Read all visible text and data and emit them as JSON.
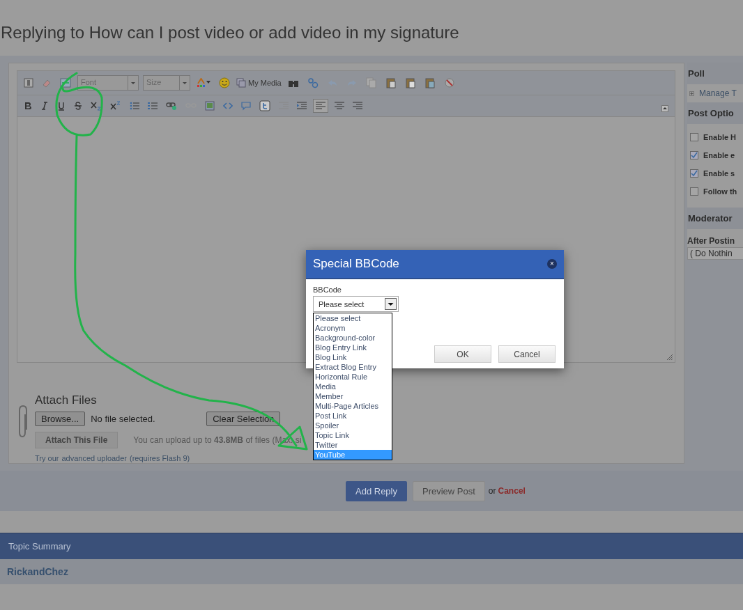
{
  "page_title": "Replying to How can I post video or add video in my signature",
  "editor": {
    "font_placeholder": "Font",
    "size_placeholder": "Size",
    "my_media": "My Media"
  },
  "attach": {
    "title": "Attach Files",
    "browse": "Browse...",
    "file_status": "No file selected.",
    "clear": "Clear Selection",
    "attach_button": "Attach This File",
    "upload_note": "You can upload up to **43.8MB** of files (Max. si",
    "uploader_prefix": "Try our",
    "uploader_link": "advanced uploader",
    "uploader_suffix": "(requires Flash 9)"
  },
  "sidebar": {
    "poll_title": "Poll",
    "manage": "Manage T",
    "options_title": "Post Optio",
    "options": [
      {
        "label": "Enable H",
        "checked": false
      },
      {
        "label": "Enable e",
        "checked": true
      },
      {
        "label": "Enable s",
        "checked": true
      },
      {
        "label": "Follow th",
        "checked": false
      }
    ],
    "moderator_title": "Moderator",
    "after_label": "After Postin",
    "after_value": "( Do Nothin"
  },
  "actions": {
    "add": "Add Reply",
    "preview": "Preview Post",
    "or": "or",
    "cancel": "Cancel"
  },
  "summary": {
    "title": "Topic Summary",
    "author": "RickandChez"
  },
  "dialog": {
    "title": "Special BBCode",
    "close": "×",
    "field_label": "BBCode",
    "select_value": "Please select",
    "ok": "OK",
    "cancel": "Cancel",
    "options": [
      {
        "label": "Please select",
        "selected": false
      },
      {
        "label": "Acronym",
        "selected": false
      },
      {
        "label": "Background-color",
        "selected": false
      },
      {
        "label": "Blog Entry Link",
        "selected": false
      },
      {
        "label": "Blog Link",
        "selected": false
      },
      {
        "label": "Extract Blog Entry",
        "selected": false
      },
      {
        "label": "Horizontal Rule",
        "selected": false
      },
      {
        "label": "Media",
        "selected": false
      },
      {
        "label": "Member",
        "selected": false
      },
      {
        "label": "Multi-Page Articles",
        "selected": false
      },
      {
        "label": "Post Link",
        "selected": false
      },
      {
        "label": "Spoiler",
        "selected": false
      },
      {
        "label": "Topic Link",
        "selected": false
      },
      {
        "label": "Twitter",
        "selected": false
      },
      {
        "label": "YouTube",
        "selected": true
      }
    ]
  }
}
